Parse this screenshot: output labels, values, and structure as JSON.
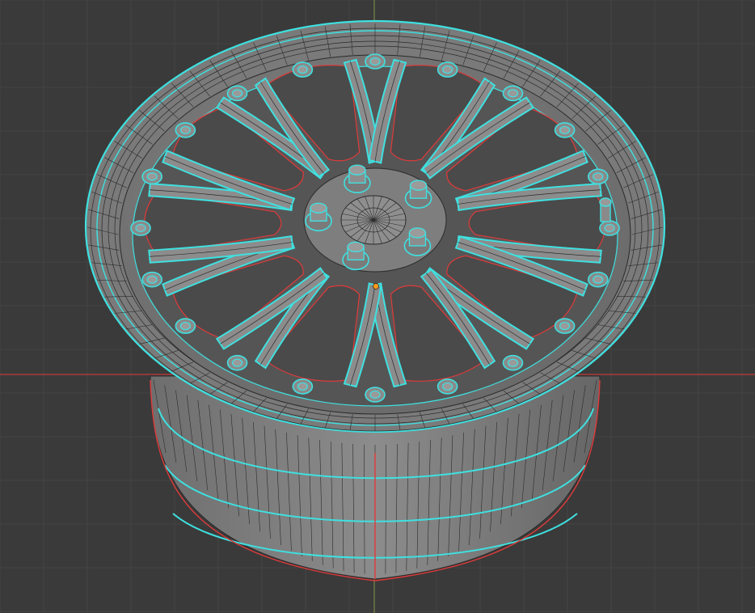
{
  "viewport": {
    "background": "#3a3a3a",
    "grid_color": "#444444",
    "x_axis_color": "#c23b3b",
    "y_axis_color": "#8aa14a"
  },
  "model": {
    "object": "alloy-wheel",
    "spoke_count": 10,
    "rim_bolt_count": 20,
    "lug_nut_count": 5,
    "mesh_color": "#7b7b7b",
    "wire_color": "#2a2a2a",
    "selected_edge_color": "#3fe0e0",
    "seam_color": "#e03a3a",
    "origin_color": "#ff9a1a"
  }
}
